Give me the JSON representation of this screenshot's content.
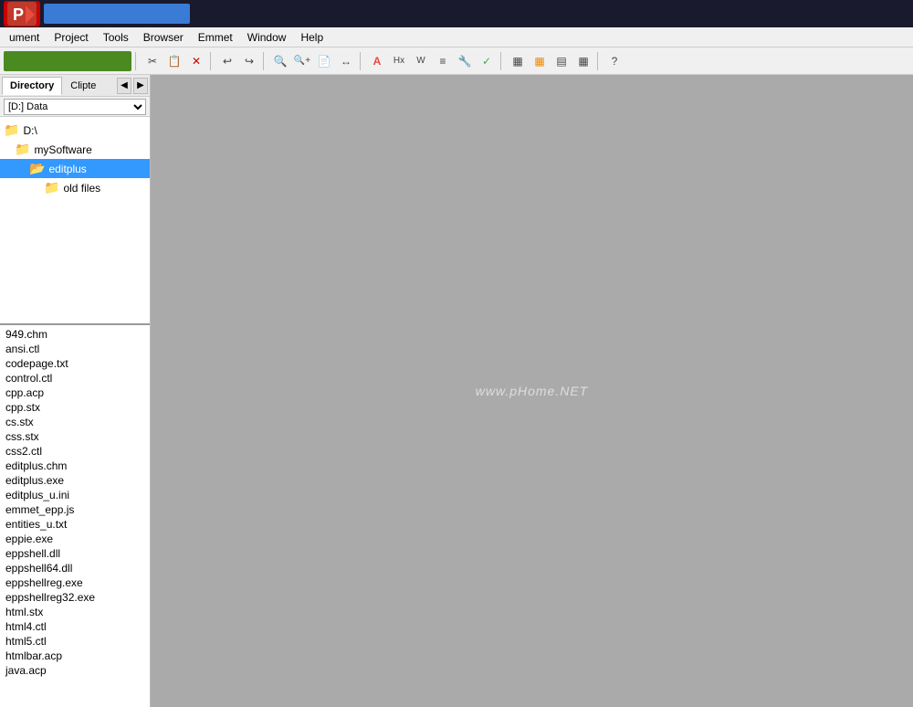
{
  "titlebar": {
    "app_logo": "P",
    "title": ""
  },
  "menubar": {
    "items": [
      {
        "id": "document",
        "label": "ument"
      },
      {
        "id": "project",
        "label": "Project"
      },
      {
        "id": "tools",
        "label": "Tools"
      },
      {
        "id": "browser",
        "label": "Browser"
      },
      {
        "id": "emmet",
        "label": "Emmet"
      },
      {
        "id": "window",
        "label": "Window"
      },
      {
        "id": "help",
        "label": "Help"
      }
    ]
  },
  "toolbar": {
    "buttons": [
      "✂",
      "📋",
      "✕",
      "↩",
      "↪",
      "🔍",
      "Aa",
      "📄",
      "↔",
      "A",
      "Hx",
      "W",
      "≡",
      "🔧",
      "✓",
      "▦",
      "▦",
      "▤",
      "▦",
      "?"
    ]
  },
  "sidebar": {
    "tabs": [
      {
        "id": "directory",
        "label": "Directory",
        "active": true
      },
      {
        "id": "cliptext",
        "label": "Clipte"
      }
    ],
    "directory_label": "[D:] Data",
    "tree": [
      {
        "id": "d-root",
        "label": "D:\\",
        "indent": 0,
        "type": "folder"
      },
      {
        "id": "mysoftware",
        "label": "mySoftware",
        "indent": 1,
        "type": "folder"
      },
      {
        "id": "editplus",
        "label": "editplus",
        "indent": 2,
        "type": "folder",
        "selected": true
      },
      {
        "id": "old-files",
        "label": "old files",
        "indent": 3,
        "type": "folder"
      }
    ],
    "files": [
      "949.chm",
      "ansi.ctl",
      "codepage.txt",
      "control.ctl",
      "cpp.acp",
      "cpp.stx",
      "cs.stx",
      "css.stx",
      "css2.ctl",
      "editplus.chm",
      "editplus.exe",
      "editplus_u.ini",
      "emmet_epp.js",
      "entities_u.txt",
      "eppie.exe",
      "eppshell.dll",
      "eppshell64.dll",
      "eppshellreg.exe",
      "eppshellreg32.exe",
      "html.stx",
      "html4.ctl",
      "html5.ctl",
      "htmlbar.acp",
      "java.acp"
    ]
  },
  "main_area": {
    "watermark": "www.pHome.NET"
  }
}
